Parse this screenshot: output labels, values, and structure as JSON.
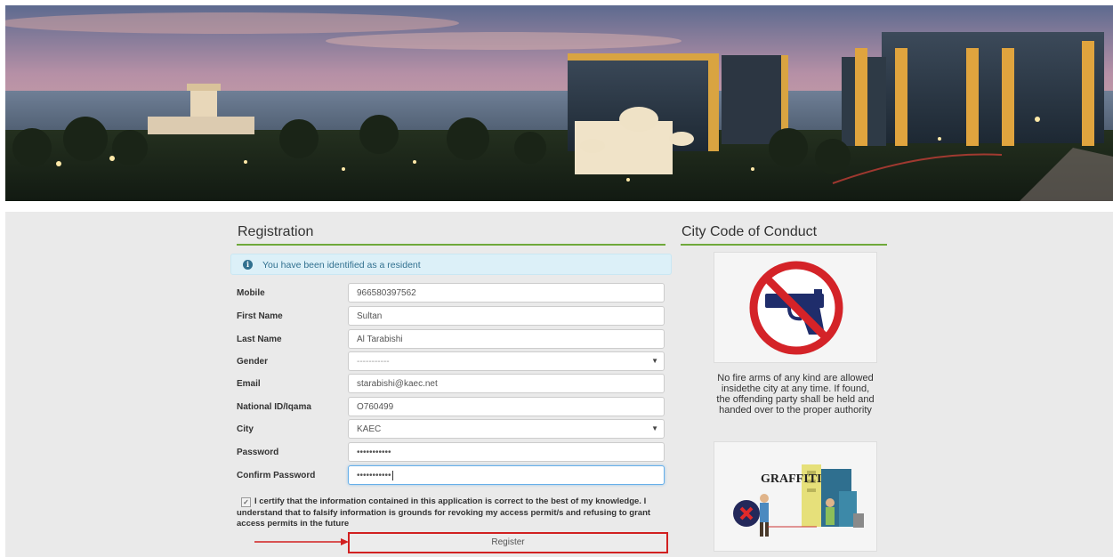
{
  "hero": {
    "image": "king-abdullah-economic-city-waterfront-at-dusk"
  },
  "registration": {
    "title": "Registration",
    "alert": {
      "icon": "info-icon",
      "text": "You have been identified as a resident"
    },
    "fields": [
      {
        "label": "Mobile",
        "value": "966580397562"
      },
      {
        "label": "First Name",
        "value": "Sultan"
      },
      {
        "label": "Last Name",
        "value": "Al Tarabishi"
      },
      {
        "label": "Gender",
        "value": "-----------"
      },
      {
        "label": "Email",
        "value": "starabishi@kaec.net"
      },
      {
        "label": "National ID/Iqama",
        "value": "O760499"
      },
      {
        "label": "City",
        "value": "KAEC"
      },
      {
        "label": "Password",
        "value": "•••••••••••"
      },
      {
        "label": "Confirm Password",
        "value": "•••••••••••"
      }
    ],
    "certify_checked": true,
    "certify_text": "I certify that the information contained in this application is correct to the best of my knowledge. I understand that to falsify information is grounds for revoking my access permit/s and refusing to grant access permits in the future",
    "register_label": "Register"
  },
  "code_of_conduct": {
    "title": "City Code of Conduct",
    "rules": [
      {
        "icon": "no-firearms-icon",
        "text": "No fire arms of any kind are allowed insidethe city at any time. If found, the offending party shall be held and handed over to the proper authority"
      },
      {
        "icon": "no-graffiti-icon",
        "sign_text": "GRAFFITI"
      }
    ]
  },
  "colors": {
    "accent_rule": "#6fa93b",
    "alert_bg": "#dcf0f8",
    "highlight": "#d12020"
  }
}
